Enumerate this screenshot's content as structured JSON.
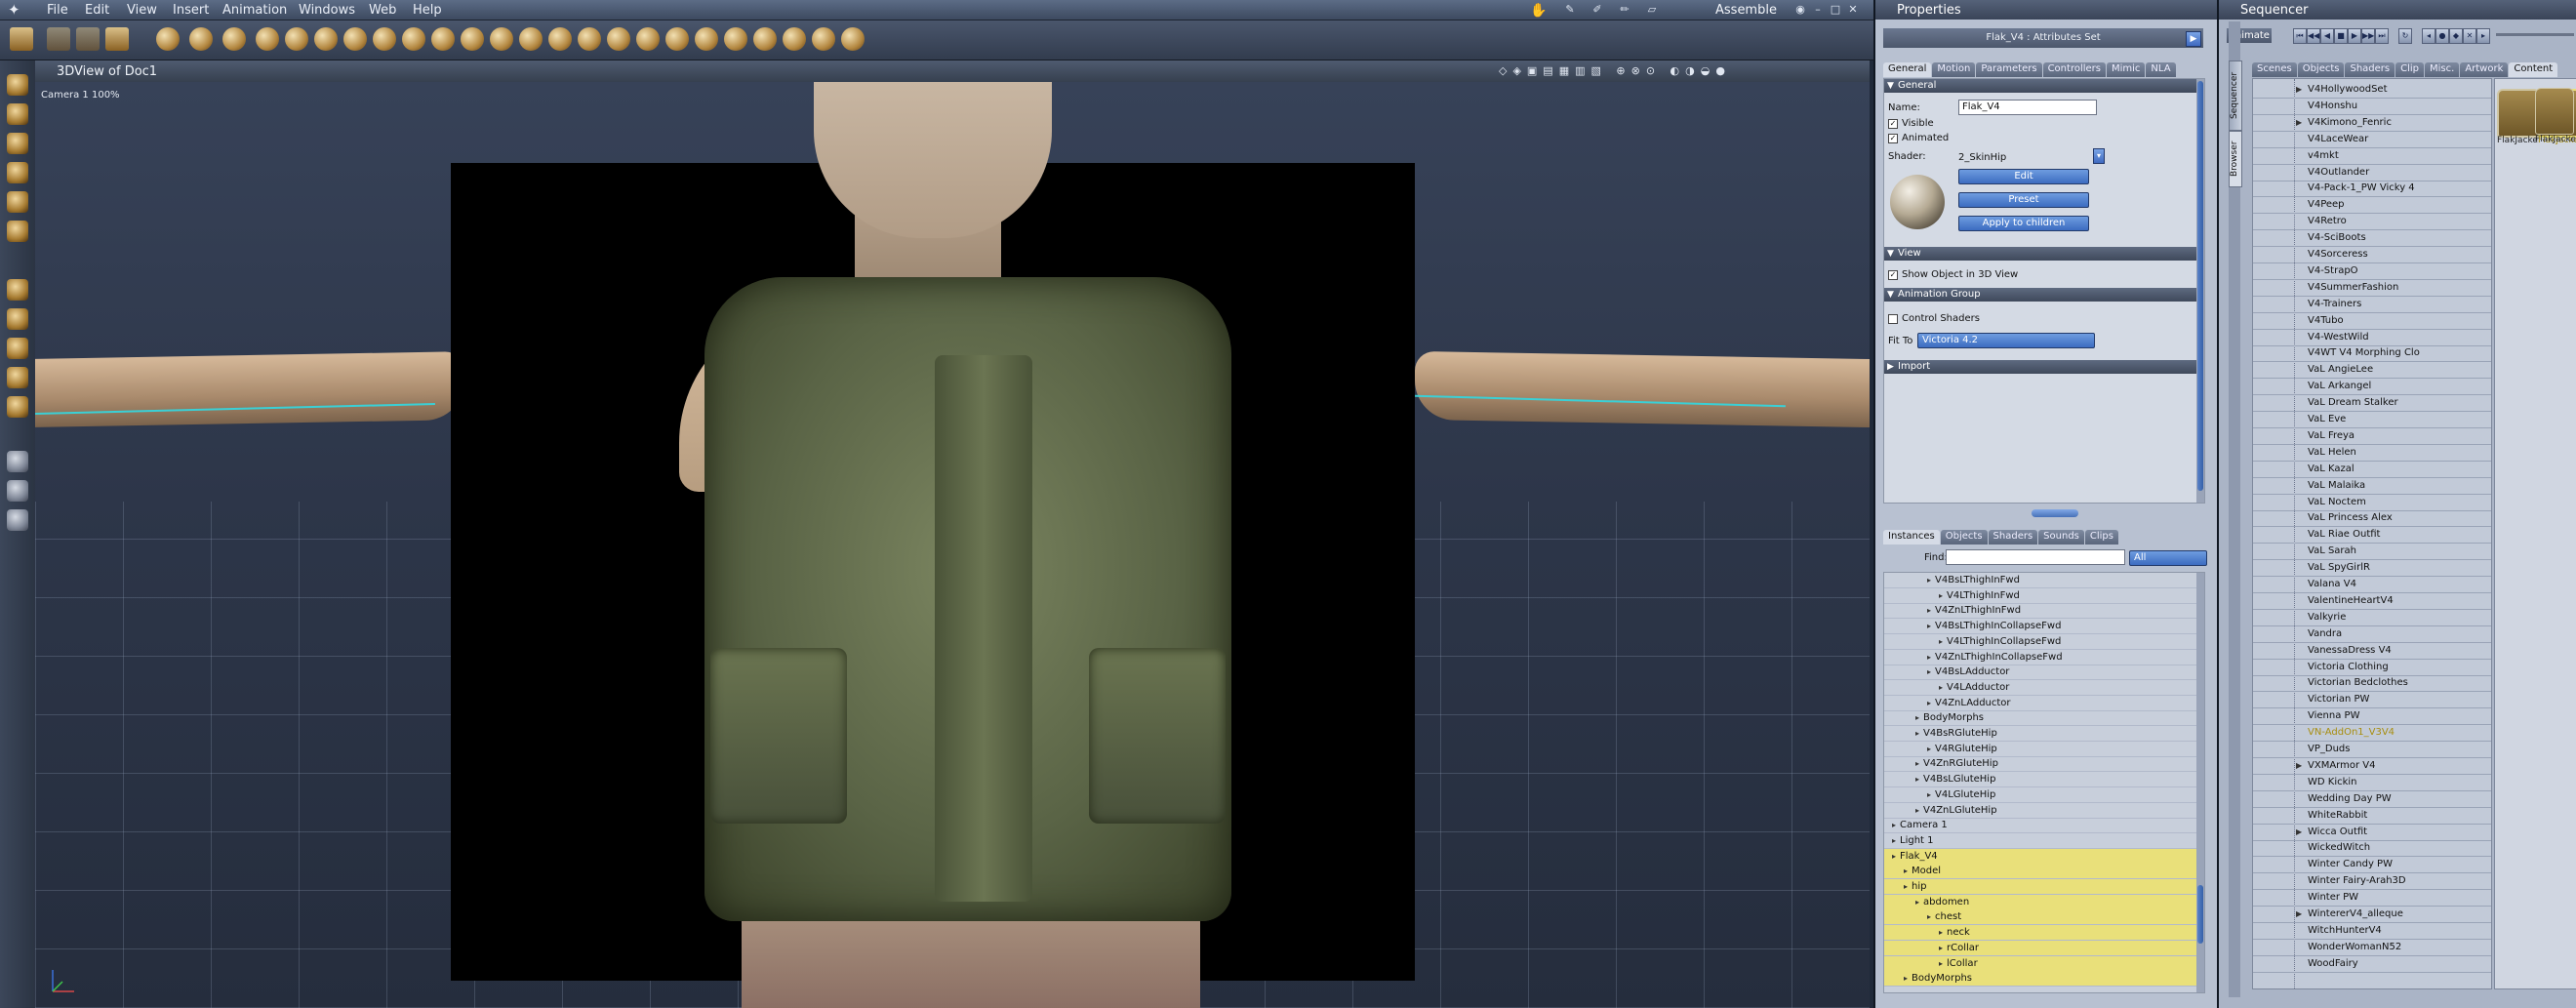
{
  "menubar": {
    "items": [
      "File",
      "Edit",
      "View",
      "Insert",
      "Animation",
      "Windows",
      "Web",
      "Help"
    ],
    "room": "Assemble"
  },
  "viewport": {
    "title": "3DView of Doc1",
    "camera_label": "Camera 1  100%"
  },
  "properties": {
    "panel_title": "Properties",
    "attr_set": "Flak_V4 : Attributes Set",
    "tabs": [
      "General",
      "Motion",
      "Parameters",
      "Controllers",
      "Mimic",
      "NLA"
    ],
    "general": {
      "section": "General",
      "name_label": "Name:",
      "name_value": "Flak_V4",
      "visible": "Visible",
      "animated": "Animated",
      "shader_label": "Shader:",
      "shader_value": "2_SkinHip",
      "edit_btn": "Edit",
      "preset_btn": "Preset",
      "apply_btn": "Apply to children"
    },
    "view": {
      "section": "View",
      "show_object": "Show Object in 3D View"
    },
    "animation_group": {
      "section": "Animation Group",
      "control_shaders": "Control Shaders",
      "fit_to_label": "Fit To",
      "fit_to_value": "Victoria 4.2"
    },
    "import_section": "Import"
  },
  "outliner": {
    "tabs": [
      "Instances",
      "Objects",
      "Shaders",
      "Sounds",
      "Clips"
    ],
    "find_label": "Find:",
    "filter_value": "All",
    "rows": [
      {
        "label": "V4BsLThighInFwd",
        "indent": 3,
        "sel": false
      },
      {
        "label": "V4LThighInFwd",
        "indent": 4,
        "sel": false
      },
      {
        "label": "V4ZnLThighInFwd",
        "indent": 3,
        "sel": false
      },
      {
        "label": "V4BsLThighInCollapseFwd",
        "indent": 3,
        "sel": false
      },
      {
        "label": "V4LThighInCollapseFwd",
        "indent": 4,
        "sel": false
      },
      {
        "label": "V4ZnLThighInCollapseFwd",
        "indent": 3,
        "sel": false
      },
      {
        "label": "V4BsLAdductor",
        "indent": 3,
        "sel": false
      },
      {
        "label": "V4LAdductor",
        "indent": 4,
        "sel": false
      },
      {
        "label": "V4ZnLAdductor",
        "indent": 3,
        "sel": false
      },
      {
        "label": "BodyMorphs",
        "indent": 2,
        "sel": false
      },
      {
        "label": "V4BsRGluteHip",
        "indent": 2,
        "sel": false
      },
      {
        "label": "V4RGluteHip",
        "indent": 3,
        "sel": false
      },
      {
        "label": "V4ZnRGluteHip",
        "indent": 2,
        "sel": false
      },
      {
        "label": "V4BsLGluteHip",
        "indent": 2,
        "sel": false
      },
      {
        "label": "V4LGluteHip",
        "indent": 3,
        "sel": false
      },
      {
        "label": "V4ZnLGluteHip",
        "indent": 2,
        "sel": false
      },
      {
        "label": "Camera 1",
        "indent": 0,
        "sel": false
      },
      {
        "label": "Light 1",
        "indent": 0,
        "sel": false
      },
      {
        "label": "Flak_V4",
        "indent": 0,
        "sel": true
      },
      {
        "label": "Model",
        "indent": 1,
        "sel": true
      },
      {
        "label": "hip",
        "indent": 1,
        "sel": true
      },
      {
        "label": "abdomen",
        "indent": 2,
        "sel": true
      },
      {
        "label": "chest",
        "indent": 3,
        "sel": true
      },
      {
        "label": "neck",
        "indent": 4,
        "sel": true
      },
      {
        "label": "rCollar",
        "indent": 4,
        "sel": true
      },
      {
        "label": "lCollar",
        "indent": 4,
        "sel": true
      },
      {
        "label": "BodyMorphs",
        "indent": 1,
        "sel": true
      }
    ]
  },
  "sequencer": {
    "panel_title": "Sequencer",
    "animate_btn": "Animate",
    "side_tabs": [
      "Sequencer",
      "Browser"
    ],
    "tabs": [
      "Scenes",
      "Objects",
      "Shaders",
      "Clip",
      "Misc.",
      "Artwork",
      "Content"
    ],
    "library": [
      {
        "label": "V4HollywoodSet",
        "twist": true,
        "sel": false
      },
      {
        "label": "V4Honshu",
        "twist": false,
        "sel": false
      },
      {
        "label": "V4Kimono_Fenric",
        "twist": true,
        "sel": false
      },
      {
        "label": "V4LaceWear",
        "twist": false,
        "sel": false
      },
      {
        "label": "v4mkt",
        "twist": false,
        "sel": false
      },
      {
        "label": "V4Outlander",
        "twist": false,
        "sel": false
      },
      {
        "label": "V4-Pack-1_PW Vicky 4",
        "twist": false,
        "sel": false
      },
      {
        "label": "V4Peep",
        "twist": false,
        "sel": false
      },
      {
        "label": "V4Retro",
        "twist": false,
        "sel": false
      },
      {
        "label": "V4-SciBoots",
        "twist": false,
        "sel": false
      },
      {
        "label": "V4Sorceress",
        "twist": false,
        "sel": false
      },
      {
        "label": "V4-StrapO",
        "twist": false,
        "sel": false
      },
      {
        "label": "V4SummerFashion",
        "twist": false,
        "sel": false
      },
      {
        "label": "V4-Trainers",
        "twist": false,
        "sel": false
      },
      {
        "label": "V4Tubo",
        "twist": false,
        "sel": false
      },
      {
        "label": "V4-WestWild",
        "twist": false,
        "sel": false
      },
      {
        "label": "V4WT V4 Morphing Clo",
        "twist": false,
        "sel": false
      },
      {
        "label": "VaL AngieLee",
        "twist": false,
        "sel": false
      },
      {
        "label": "VaL Arkangel",
        "twist": false,
        "sel": false
      },
      {
        "label": "VaL Dream Stalker",
        "twist": false,
        "sel": false
      },
      {
        "label": "VaL Eve",
        "twist": false,
        "sel": false
      },
      {
        "label": "VaL Freya",
        "twist": false,
        "sel": false
      },
      {
        "label": "VaL Helen",
        "twist": false,
        "sel": false
      },
      {
        "label": "VaL Kazal",
        "twist": false,
        "sel": false
      },
      {
        "label": "VaL Malaika",
        "twist": false,
        "sel": false
      },
      {
        "label": "VaL Noctem",
        "twist": false,
        "sel": false
      },
      {
        "label": "VaL Princess Alex",
        "twist": false,
        "sel": false
      },
      {
        "label": "VaL Riae Outfit",
        "twist": false,
        "sel": false
      },
      {
        "label": "VaL Sarah",
        "twist": false,
        "sel": false
      },
      {
        "label": "VaL SpyGirlR",
        "twist": false,
        "sel": false
      },
      {
        "label": "Valana V4",
        "twist": false,
        "sel": false
      },
      {
        "label": "ValentineHeartV4",
        "twist": false,
        "sel": false
      },
      {
        "label": "Valkyrie",
        "twist": false,
        "sel": false
      },
      {
        "label": "Vandra",
        "twist": false,
        "sel": false
      },
      {
        "label": "VanessaDress V4",
        "twist": false,
        "sel": false
      },
      {
        "label": "Victoria Clothing",
        "twist": false,
        "sel": false
      },
      {
        "label": "Victorian Bedclothes",
        "twist": false,
        "sel": false
      },
      {
        "label": "Victorian PW",
        "twist": false,
        "sel": false
      },
      {
        "label": "Vienna PW",
        "twist": false,
        "sel": false
      },
      {
        "label": "VN-AddOn1_V3V4",
        "twist": false,
        "sel": true
      },
      {
        "label": "VP_Duds",
        "twist": false,
        "sel": false
      },
      {
        "label": "VXMArmor V4",
        "twist": true,
        "sel": false
      },
      {
        "label": "WD Kickin",
        "twist": false,
        "sel": false
      },
      {
        "label": "Wedding Day PW",
        "twist": false,
        "sel": false
      },
      {
        "label": "WhiteRabbit",
        "twist": false,
        "sel": false
      },
      {
        "label": "Wicca Outfit",
        "twist": true,
        "sel": false
      },
      {
        "label": "WickedWitch",
        "twist": false,
        "sel": false
      },
      {
        "label": "Winter Candy PW",
        "twist": false,
        "sel": false
      },
      {
        "label": "Winter Fairy-Arah3D",
        "twist": false,
        "sel": false
      },
      {
        "label": "Winter PW",
        "twist": false,
        "sel": false
      },
      {
        "label": "WintererV4_alleque",
        "twist": true,
        "sel": false
      },
      {
        "label": "WitchHunterV4",
        "twist": false,
        "sel": false
      },
      {
        "label": "WonderWomanN52",
        "twist": false,
        "sel": false
      },
      {
        "label": "WoodFairy",
        "twist": false,
        "sel": false
      }
    ],
    "thumbnails": [
      "FlakJacke",
      "FlakJacke",
      "FlakJacket"
    ]
  },
  "colors": {
    "selection": "#e9e07a",
    "accent_blue": "#3c6cc0",
    "bone_line": "#3ad0d6"
  }
}
